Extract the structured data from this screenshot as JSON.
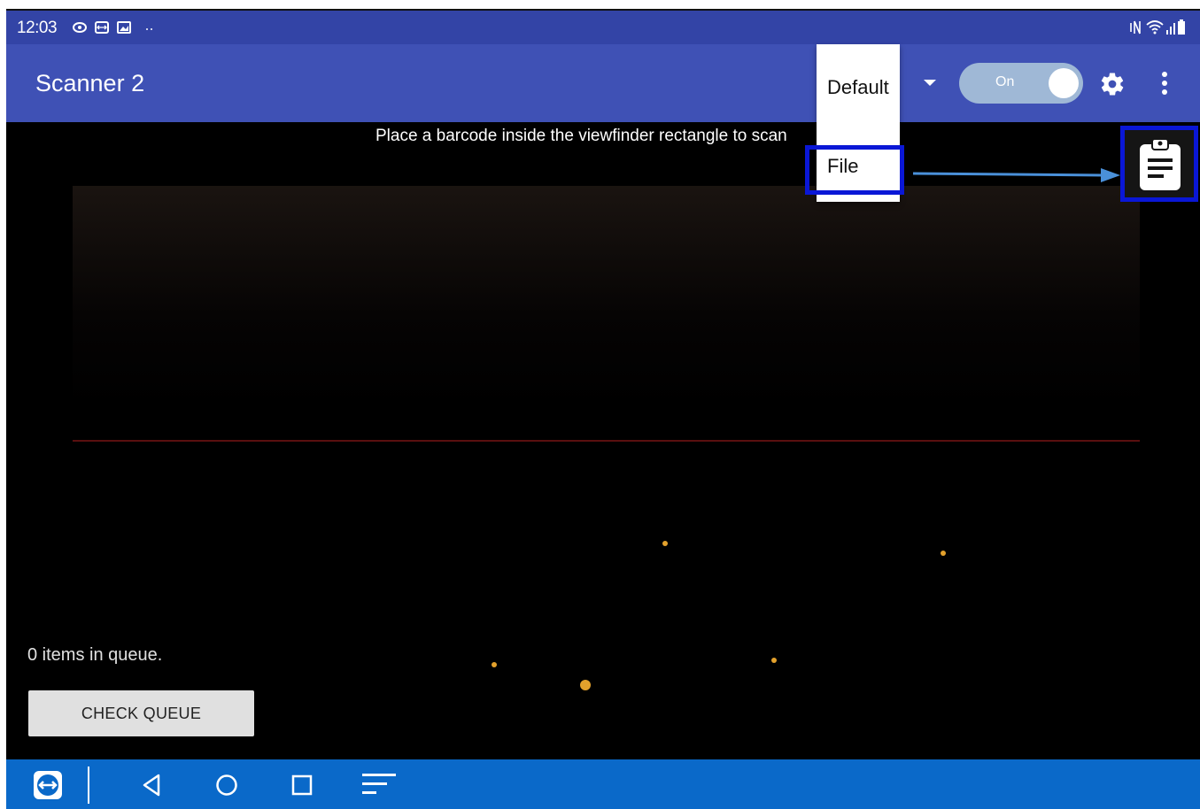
{
  "status_bar": {
    "time": "12:03"
  },
  "app_bar": {
    "title": "Scanner 2",
    "toggle_label": "On"
  },
  "menu": {
    "items": [
      {
        "label": "Default"
      },
      {
        "label": "File"
      }
    ]
  },
  "camera": {
    "instruction": "Place a barcode inside the viewfinder rectangle to scan"
  },
  "queue": {
    "status_text": "0 items in queue.",
    "check_button_label": "CHECK QUEUE"
  },
  "colors": {
    "status_bar": "#3344a6",
    "app_bar": "#3f51b5",
    "nav_bar": "#0a69c9",
    "highlight": "#0a17d6",
    "arrow": "#4a90d9"
  },
  "icons": {
    "settings": "gear-icon",
    "more": "more-vert-icon",
    "clipboard": "clipboard-icon",
    "nav": [
      "teamviewer-icon",
      "back-icon",
      "home-icon",
      "recents-icon",
      "menu-icon"
    ]
  }
}
